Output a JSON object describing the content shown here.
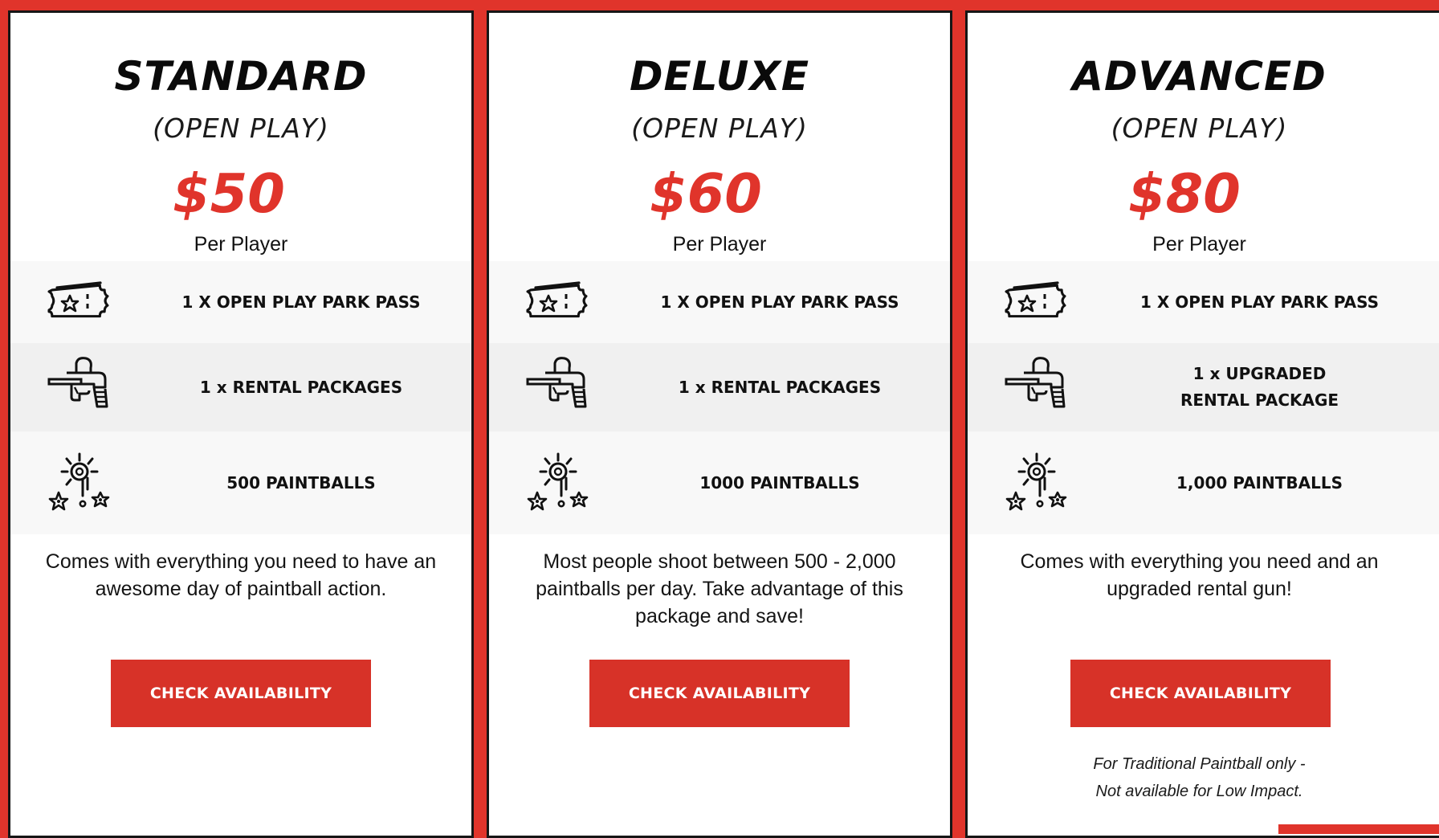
{
  "theme": {
    "accent": "#e0342b",
    "button": "#d73228",
    "text": "#111111",
    "row_light": "#f8f8f8",
    "row_dark": "#f0f0f0"
  },
  "plans": [
    {
      "title": "STANDARD",
      "subtitle": "(OPEN PLAY)",
      "price": "$50",
      "per": "Per Player",
      "features": [
        {
          "icon": "ticket-icon",
          "text": "1 X OPEN PLAY PARK PASS"
        },
        {
          "icon": "paintball-gun-icon",
          "text": "1 x RENTAL PACKAGES"
        },
        {
          "icon": "paintball-splat-icon",
          "text": "500  PAINTBALLS"
        }
      ],
      "description": "Comes with everything you need to have an awesome day of paintball action.",
      "button": "CHECK AVAILABILITY"
    },
    {
      "title": "DELUXE",
      "subtitle": "(OPEN PLAY)",
      "price": "$60",
      "per": "Per Player",
      "features": [
        {
          "icon": "ticket-icon",
          "text": "1 X OPEN PLAY PARK PASS"
        },
        {
          "icon": "paintball-gun-icon",
          "text": "1 x RENTAL PACKAGES"
        },
        {
          "icon": "paintball-splat-icon",
          "text": "1000  PAINTBALLS"
        }
      ],
      "description": "Most people shoot between 500 - 2,000 paintballs per day. Take advantage of this package and save!",
      "button": "CHECK AVAILABILITY"
    },
    {
      "title": "ADVANCED",
      "subtitle": "(OPEN PLAY)",
      "price": "$80",
      "per": "Per Player",
      "features": [
        {
          "icon": "ticket-icon",
          "text": "1 X OPEN PLAY PARK PASS"
        },
        {
          "icon": "paintball-gun-icon",
          "text": "1 x UPGRADED\nRENTAL PACKAGE"
        },
        {
          "icon": "paintball-splat-icon",
          "text": "1,000  PAINTBALLS"
        }
      ],
      "description": "Comes with everything you need and an upgraded rental gun!",
      "button": "CHECK AVAILABILITY",
      "note": "For Traditional Paintball only -\nNot available for Low Impact."
    }
  ]
}
